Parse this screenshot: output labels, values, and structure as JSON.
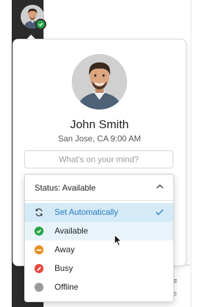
{
  "profile": {
    "name": "John Smith",
    "location": "San Jose, CA 9:00 AM",
    "mind_placeholder": "What's on your mind?",
    "mind_value": ""
  },
  "status": {
    "header_label": "Status: Available",
    "options": [
      {
        "label": "Set Automatically",
        "icon": "sync-icon",
        "color": "#2b7bbf",
        "selected": true
      },
      {
        "label": "Available",
        "icon": "available-check-icon",
        "color": "#2aa547",
        "selected": false
      },
      {
        "label": "Away",
        "icon": "away-icon",
        "color": "#e8901f",
        "selected": false
      },
      {
        "label": "Busy",
        "icon": "busy-icon",
        "color": "#e8453c",
        "selected": false
      },
      {
        "label": "Offline",
        "icon": "offline-icon",
        "color": "#9a9a9a",
        "selected": false
      }
    ]
  },
  "colors": {
    "accent": "#2b7bbf",
    "selected_bg": "#d4eaf7",
    "sidebar": "#2b2b2b",
    "presence_available": "#2aa547"
  }
}
